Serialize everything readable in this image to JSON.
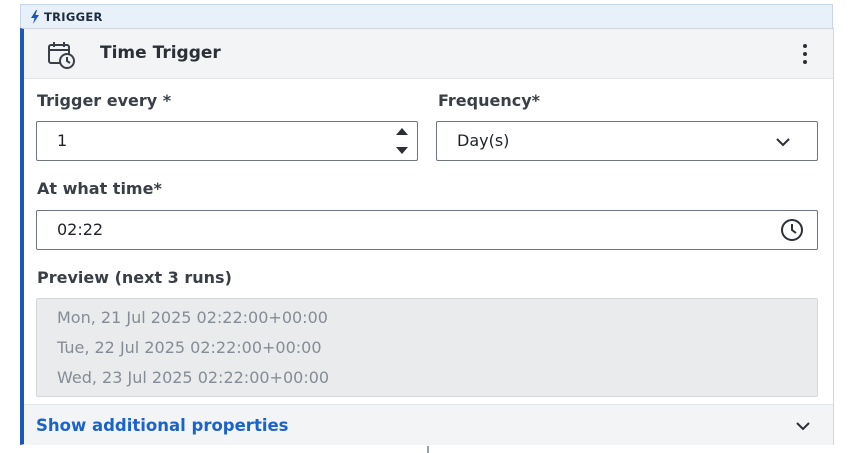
{
  "trigger_tag": {
    "label": "TRIGGER",
    "icon": "lightning-bolt-icon"
  },
  "card": {
    "title": "Time Trigger",
    "icon": "calendar-clock-icon",
    "menu_icon": "more-vertical-icon",
    "accent_color": "#1a58b5"
  },
  "fields": {
    "trigger_every": {
      "label": "Trigger every *",
      "value": "1"
    },
    "frequency": {
      "label": "Frequency*",
      "value": "Day(s)"
    },
    "at_what_time": {
      "label": "At what time*",
      "value": "02:22",
      "icon": "clock-icon"
    }
  },
  "preview": {
    "label": "Preview (next 3 runs)",
    "runs": [
      "Mon, 21 Jul 2025 02:22:00+00:00",
      "Tue, 22 Jul 2025 02:22:00+00:00",
      "Wed, 23 Jul 2025 02:22:00+00:00"
    ]
  },
  "footer": {
    "link_label": "Show additional properties",
    "link_color": "#1a63c9"
  }
}
